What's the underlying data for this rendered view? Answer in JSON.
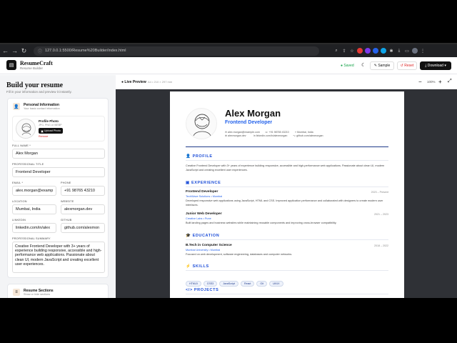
{
  "browser": {
    "url": "127.0.0.1:5500/Resume%20Builder/index.html"
  },
  "app": {
    "name": "ResumeCraft",
    "tagline": "Resume Builder",
    "saved": "Saved",
    "sample": "Sample",
    "reset": "Reset",
    "download": "Download"
  },
  "left": {
    "title": "Build your resume",
    "subtitle": "Fill in your information and preview it instantly.",
    "personal": {
      "title": "Personal Information",
      "subtitle": "Your basic contact information",
      "photo_label": "Profile Photo",
      "photo_hint": "JPG, PNG or WEBP",
      "upload": "Upload Photo",
      "remove": "Remove"
    },
    "fields": {
      "full_name_label": "FULL NAME *",
      "full_name": "Alex Morgan",
      "title_label": "PROFESSIONAL TITLE",
      "title": "Frontend Developer",
      "email_label": "EMAIL *",
      "email": "alex.morgan@examp",
      "phone_label": "PHONE",
      "phone": "+91 98765 43210",
      "location_label": "LOCATION",
      "location": "Mumbai, India",
      "website_label": "WEBSITE",
      "website": "alexmorgan.dev",
      "linkedin_label": "LINKEDIN",
      "linkedin": "linkedin.com/in/alex",
      "github_label": "GITHUB",
      "github": "github.com/alexmon",
      "summary_label": "PROFESSIONAL SUMMARY",
      "summary": "Creative Frontend Developer with 3+ years of experience building responsive, accessible and high-performance web applications. Passionate about clean UI, modern JavaScript and creating excellent user experiences."
    },
    "sections_card": {
      "title": "Resume Sections",
      "subtitle": "Show or hide sections"
    }
  },
  "preview": {
    "label": "Live Preview",
    "size": "A4 • 210 × 297 mm",
    "zoom": "100%"
  },
  "resume": {
    "name": "Alex Morgan",
    "role": "Frontend Developer",
    "email": "alex.morgan@example.com",
    "phone": "+91 98765 43210",
    "location": "Mumbai, India",
    "website": "alexmorgan.dev",
    "linkedin": "linkedin.com/in/alexmorgan",
    "github": "github.com/alexmorgan",
    "profile_heading": "PROFILE",
    "profile_text": "Creative Frontend Developer with 3+ years of experience building responsive, accessible and high-performance web applications. Passionate about clean UI, modern JavaScript and creating excellent user experiences.",
    "experience_heading": "EXPERIENCE",
    "jobs": [
      {
        "title": "Frontend Developer",
        "company": "TechWave Solutions • Mumbai",
        "dates": "2023 – Present",
        "desc": "Developed responsive web applications using JavaScript, HTML and CSS. Improved application performance and collaborated with designers to create modern user interfaces."
      },
      {
        "title": "Junior Web Developer",
        "company": "Creative Labs • Pune",
        "dates": "2021 – 2023",
        "desc": "Built landing pages and business websites while maintaining reusable components and improving cross-browser compatibility."
      }
    ],
    "education_heading": "EDUCATION",
    "edu": {
      "degree": "B.Tech in Computer Science",
      "school": "Mumbai University • Mumbai",
      "dates": "2018 – 2022",
      "desc": "Focused on web development, software engineering, databases and computer networks."
    },
    "skills_heading": "SKILLS",
    "skills": [
      "HTML5",
      "CSS3",
      "JavaScript",
      "React",
      "Git",
      "UI/UX"
    ],
    "projects_heading": "PROJECTS"
  }
}
